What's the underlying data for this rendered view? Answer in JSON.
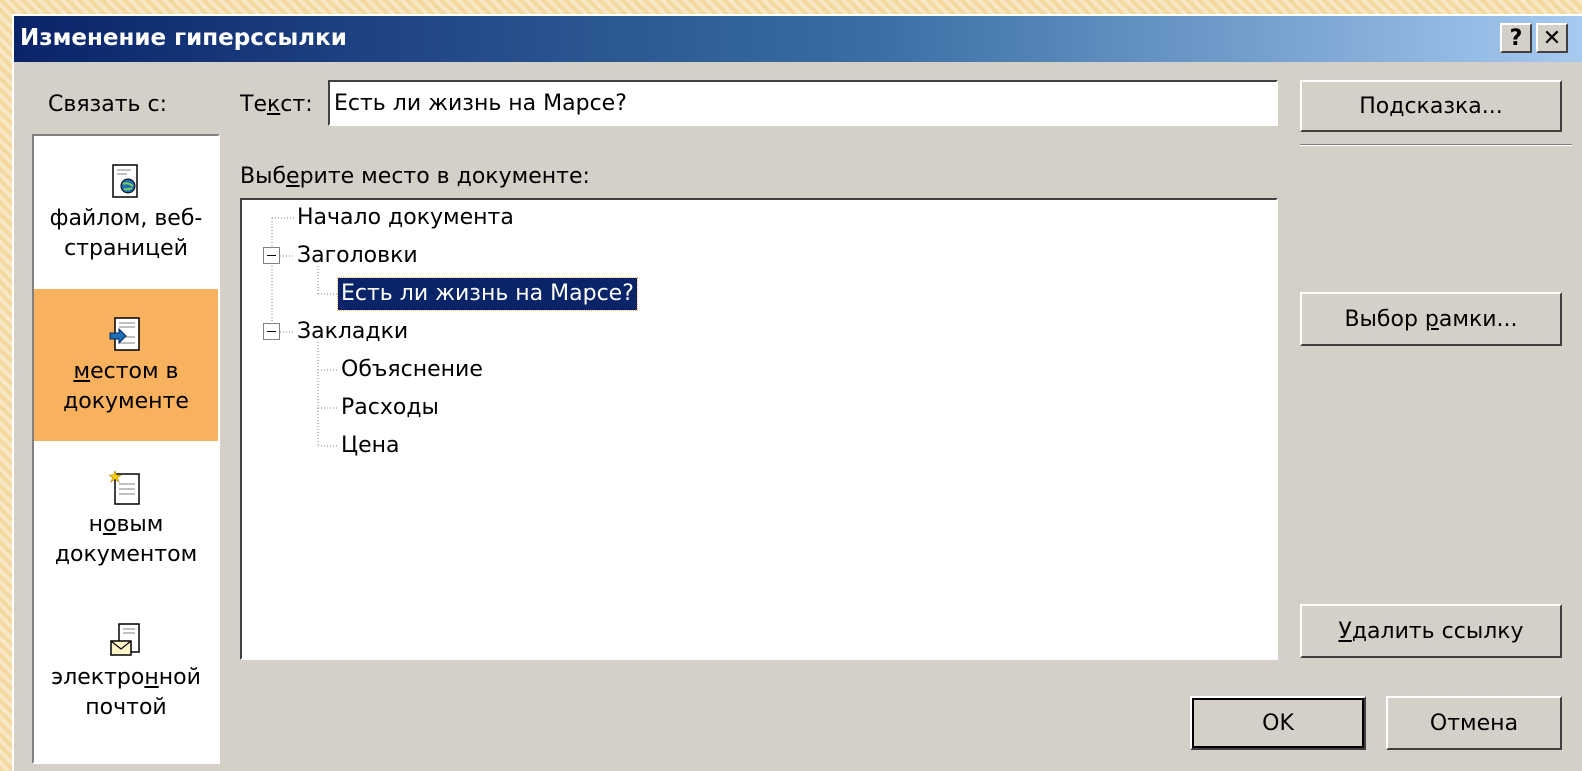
{
  "window": {
    "title": "Изменение гиперссылки",
    "help_button": "?",
    "close_button": "✕"
  },
  "link_to": {
    "label": "Связать с:",
    "items": [
      {
        "label_line1": "файлом, веб-",
        "label_line2": "страницей",
        "icon": "web-page-icon",
        "selected": false
      },
      {
        "label_line1": "местом в",
        "label_line2": "документе",
        "icon": "place-in-document-icon",
        "selected": true
      },
      {
        "label_line1": "новым",
        "label_line2": "документом",
        "icon": "new-document-icon",
        "selected": false
      },
      {
        "label_line1": "электронной",
        "label_line2": "почтой",
        "icon": "email-icon",
        "selected": false
      }
    ]
  },
  "text_field": {
    "label": "Текст:",
    "value": "Есть ли жизнь на Марсе?"
  },
  "tree": {
    "label": "Выберите место в документе:",
    "nodes": [
      {
        "label": "Начало документа",
        "level": 0
      },
      {
        "label": "Заголовки",
        "level": 0,
        "expanded": true
      },
      {
        "label": "Есть ли жизнь на Марсе?",
        "level": 1,
        "selected": true
      },
      {
        "label": "Закладки",
        "level": 0,
        "expanded": true
      },
      {
        "label": "Объяснение",
        "level": 1
      },
      {
        "label": "Расходы",
        "level": 1
      },
      {
        "label": "Цена",
        "level": 1
      }
    ]
  },
  "buttons": {
    "hint": "Подсказка...",
    "frame": "Выбор рамки...",
    "remove_link": "Удалить ссылку",
    "ok": "OK",
    "cancel": "Отмена"
  },
  "colors": {
    "dialog_bg": "#d4d0c8",
    "title_start": "#0a246a",
    "title_end": "#a6caf0",
    "selected_link_bg": "#f8b15c",
    "tree_selection": "#0a246a"
  }
}
